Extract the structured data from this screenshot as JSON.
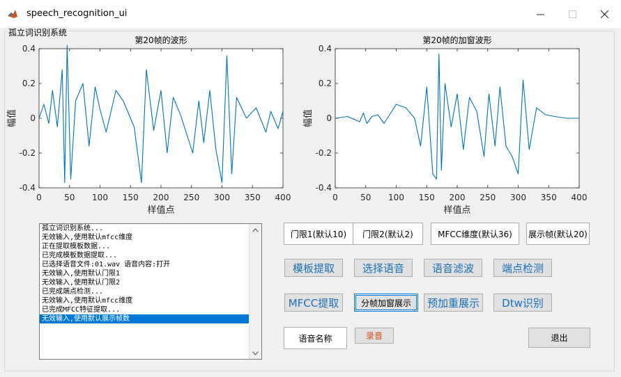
{
  "window": {
    "title": "speech_recognition_ui",
    "minimize_icon": "minimize-icon",
    "maximize_icon": "maximize-icon",
    "close_icon": "close-icon"
  },
  "panel": {
    "title": "孤立词识别系统"
  },
  "plots": [
    {
      "title": "第20帧的波形",
      "xlabel": "样值点",
      "ylabel": "幅值"
    },
    {
      "title": "第20帧的加窗波形",
      "xlabel": "样值点",
      "ylabel": "幅值"
    }
  ],
  "chart_data": [
    {
      "type": "line",
      "title": "第20帧的波形",
      "xlabel": "样值点",
      "ylabel": "幅值",
      "xlim": [
        0,
        400
      ],
      "ylim": [
        -0.4,
        0.4
      ],
      "xticks": [
        0,
        50,
        100,
        150,
        200,
        250,
        300,
        350,
        400
      ],
      "yticks": [
        -0.4,
        -0.2,
        0,
        0.2,
        0.4
      ],
      "series": [
        {
          "color": "#0072bd",
          "x": [
            0,
            8,
            16,
            22,
            30,
            38,
            42,
            46,
            52,
            60,
            72,
            82,
            92,
            100,
            110,
            126,
            138,
            156,
            168,
            176,
            188,
            200,
            210,
            220,
            232,
            252,
            262,
            270,
            280,
            290,
            300,
            308,
            316,
            324,
            340,
            356,
            372,
            380,
            392,
            400
          ],
          "y": [
            0.0,
            0.08,
            -0.03,
            0.16,
            -0.05,
            0.28,
            -0.37,
            0.42,
            -0.35,
            0.1,
            0.2,
            -0.16,
            0.18,
            0.05,
            -0.08,
            0.16,
            0.1,
            -0.05,
            -0.37,
            0.28,
            -0.07,
            0.16,
            -0.2,
            0.12,
            0.02,
            -0.2,
            0.1,
            -0.14,
            0.16,
            -0.18,
            -0.37,
            0.36,
            -0.32,
            0.12,
            0.0,
            0.06,
            -0.08,
            0.04,
            -0.06,
            0.04
          ]
        }
      ]
    },
    {
      "type": "line",
      "title": "第20帧的加窗波形",
      "xlabel": "样值点",
      "ylabel": "幅值",
      "xlim": [
        0,
        400
      ],
      "ylim": [
        -0.4,
        0.4
      ],
      "xticks": [
        0,
        50,
        100,
        150,
        200,
        250,
        300,
        350,
        400
      ],
      "yticks": [
        -0.4,
        -0.2,
        0,
        0.2,
        0.4
      ],
      "series": [
        {
          "color": "#0072bd",
          "x": [
            0,
            20,
            40,
            46,
            52,
            60,
            70,
            80,
            100,
            116,
            130,
            140,
            150,
            160,
            166,
            170,
            174,
            180,
            190,
            200,
            210,
            220,
            232,
            244,
            252,
            262,
            270,
            280,
            290,
            300,
            308,
            318,
            330,
            345,
            360,
            380,
            400
          ],
          "y": [
            0.0,
            0.01,
            -0.02,
            0.03,
            -0.03,
            0.01,
            0.02,
            -0.03,
            0.08,
            0.06,
            0.0,
            -0.16,
            0.18,
            -0.32,
            -0.35,
            0.37,
            -0.3,
            0.2,
            -0.05,
            0.14,
            -0.18,
            0.12,
            0.04,
            -0.22,
            0.14,
            -0.16,
            0.18,
            -0.16,
            -0.22,
            -0.32,
            0.22,
            -0.18,
            0.06,
            0.02,
            0.01,
            0.0,
            0.0
          ]
        }
      ]
    }
  ],
  "log": {
    "lines": [
      "孤立词识别系统...",
      "无效输入,使用默认mfcc维度",
      "正在提取模板数据...",
      "已完成模板数据提取...",
      "已选择语音文件:01.wav 语音内容:打开",
      "无效输入,使用默认门限1",
      "无效输入,使用默认门限2",
      "已完成端点检测...",
      "无效输入,使用默认mfcc维度",
      "已完成MFCC特征提取...",
      "无效输入,使用默认展示帧数"
    ],
    "selected_index": 10
  },
  "inputs": {
    "threshold1": "门限1(默认10)",
    "threshold2": "门限2(默认2)",
    "mfcc_dim": "MFCC维度(默认36)",
    "frame": "展示帧(默认20)",
    "voice_name": "语音名称"
  },
  "buttons": {
    "template_extract": "模板提取",
    "select_voice": "选择语音",
    "voice_filter": "语音滤波",
    "endpoint_detect": "端点检测",
    "mfcc_extract": "MFCC提取",
    "frame_window": "分帧加窗展示",
    "preemphasis": "预加重展示",
    "dtw": "Dtw识别",
    "record": "录音",
    "exit": "退出"
  },
  "colors": {
    "line": "#0072bd",
    "button_text": "#1a6fb6",
    "record_text": "#d9480f",
    "selection": "#0078d7"
  }
}
